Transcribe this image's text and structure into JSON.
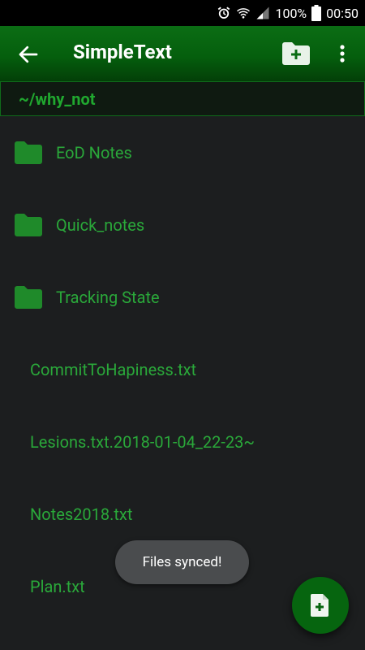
{
  "status_bar": {
    "battery": "100%",
    "time": "00:50",
    "icons": [
      "alarm-icon",
      "wifi-icon",
      "signal-icon",
      "battery-icon"
    ]
  },
  "app_bar": {
    "title": "SimpleText",
    "icons": [
      "back-arrow-icon",
      "new-folder-icon",
      "more-vert-icon"
    ]
  },
  "path": "~/why_not",
  "folders": [
    {
      "name": "EoD Notes"
    },
    {
      "name": "Quick_notes"
    },
    {
      "name": "Tracking State"
    }
  ],
  "files": [
    {
      "name": "CommitToHapiness.txt"
    },
    {
      "name": "Lesions.txt.2018-01-04_22-23~"
    },
    {
      "name": "Notes2018.txt"
    },
    {
      "name": "Plan.txt"
    }
  ],
  "toast": "Files synced!",
  "fab_icon": "new-file-icon",
  "colors": {
    "background": "#1c1e1f",
    "accent": "#2aa83a",
    "app_bar": "#055f0d"
  }
}
